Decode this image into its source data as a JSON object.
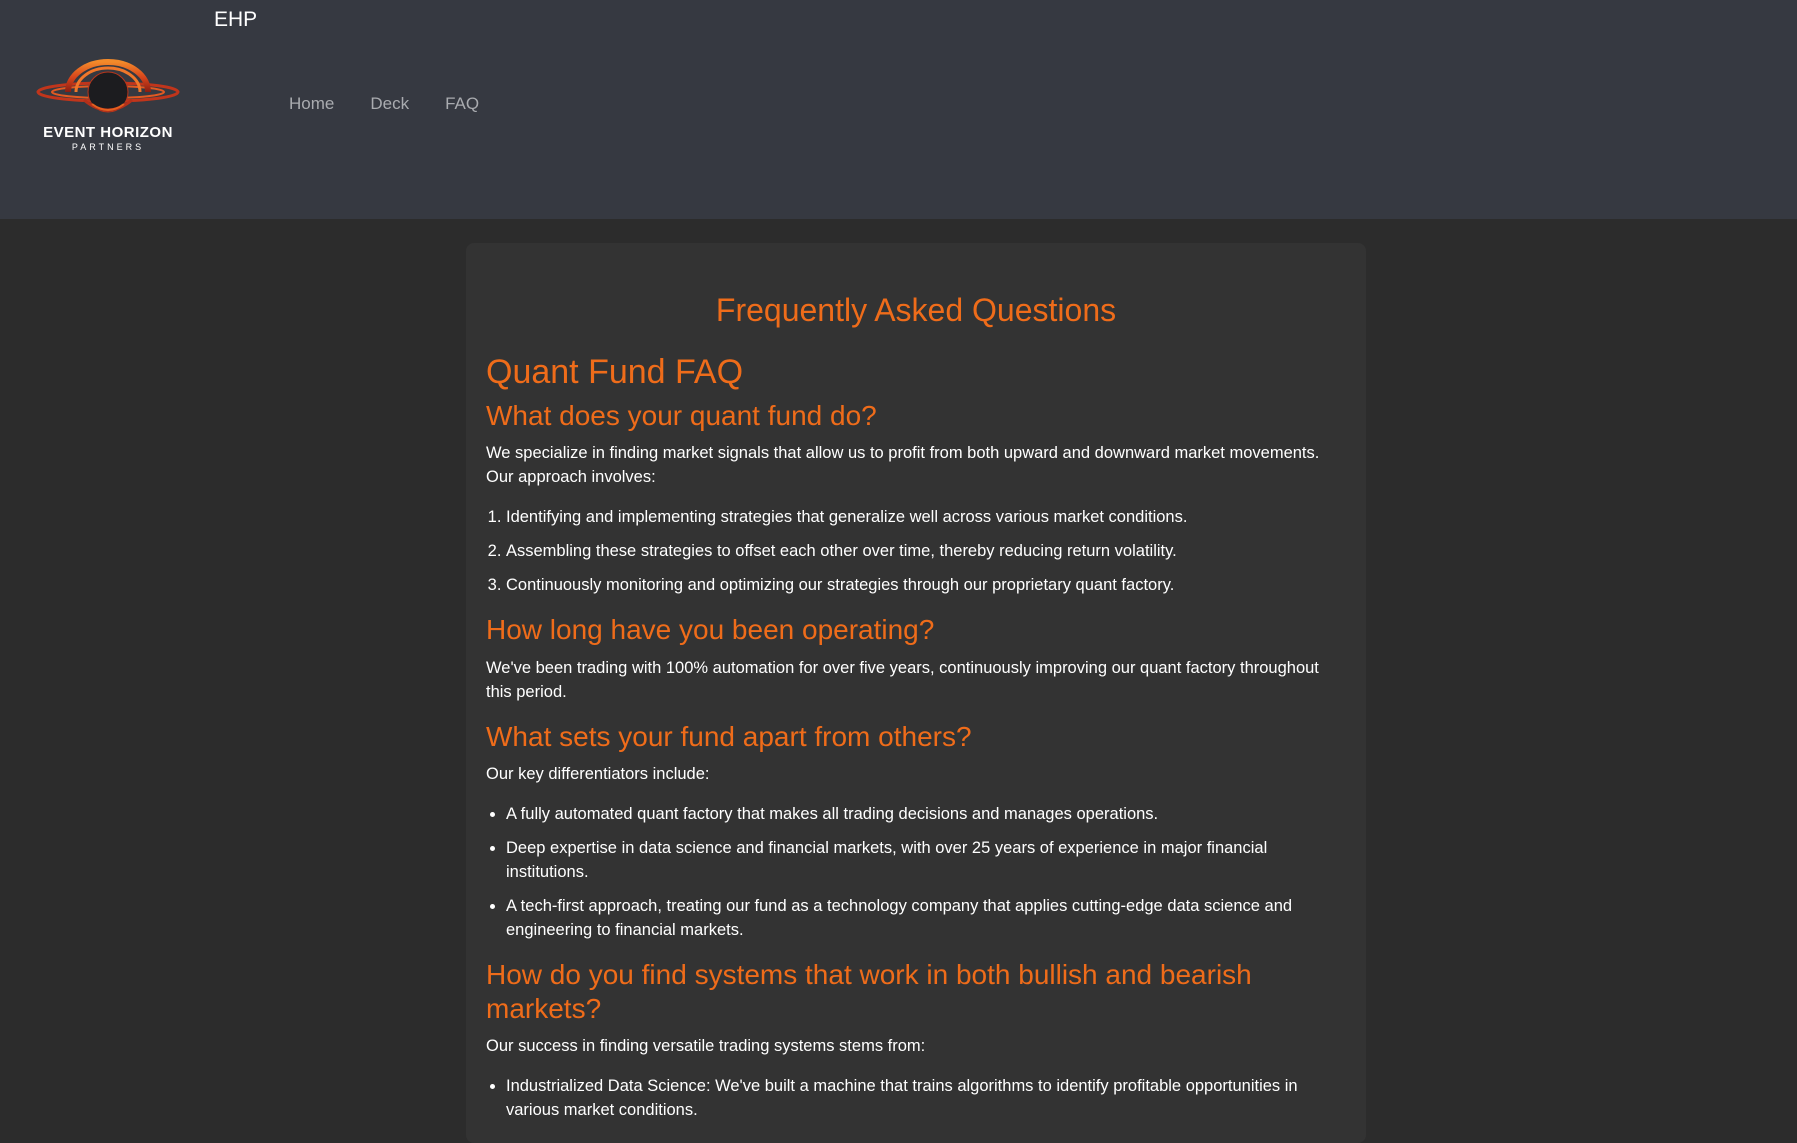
{
  "header": {
    "site_name": "EHP",
    "logo": {
      "icon": "event-horizon-logo-icon",
      "line1": "EVENT HORIZON",
      "line2": "PARTNERS"
    },
    "nav": [
      {
        "label": "Home"
      },
      {
        "label": "Deck"
      },
      {
        "label": "FAQ"
      }
    ]
  },
  "colors": {
    "header_bg": "#363941",
    "page_bg": "#2c2c2c",
    "card_bg": "#333333",
    "accent": "#ef6c1a",
    "nav_text": "#a9abaf"
  },
  "main": {
    "title": "Frequently Asked Questions",
    "section_title": "Quant Fund FAQ",
    "q1": {
      "question": "What does your quant fund do?",
      "intro": "We specialize in finding market signals that allow us to profit from both upward and downward market movements. Our approach involves:",
      "items": [
        "Identifying and implementing strategies that generalize well across various market conditions.",
        "Assembling these strategies to offset each other over time, thereby reducing return volatility.",
        "Continuously monitoring and optimizing our strategies through our proprietary quant factory."
      ]
    },
    "q2": {
      "question": "How long have you been operating?",
      "answer": "We've been trading with 100% automation for over five years, continuously improving our quant factory throughout this period."
    },
    "q3": {
      "question": "What sets your fund apart from others?",
      "intro": "Our key differentiators include:",
      "items": [
        "A fully automated quant factory that makes all trading decisions and manages operations.",
        "Deep expertise in data science and financial markets, with over 25 years of experience in major financial institutions.",
        "A tech-first approach, treating our fund as a technology company that applies cutting-edge data science and engineering to financial markets."
      ]
    },
    "q4": {
      "question": "How do you find systems that work in both bullish and bearish markets?",
      "intro": "Our success in finding versatile trading systems stems from:",
      "items": [
        "Industrialized Data Science: We've built a machine that trains algorithms to identify profitable opportunities in various market conditions."
      ]
    }
  }
}
